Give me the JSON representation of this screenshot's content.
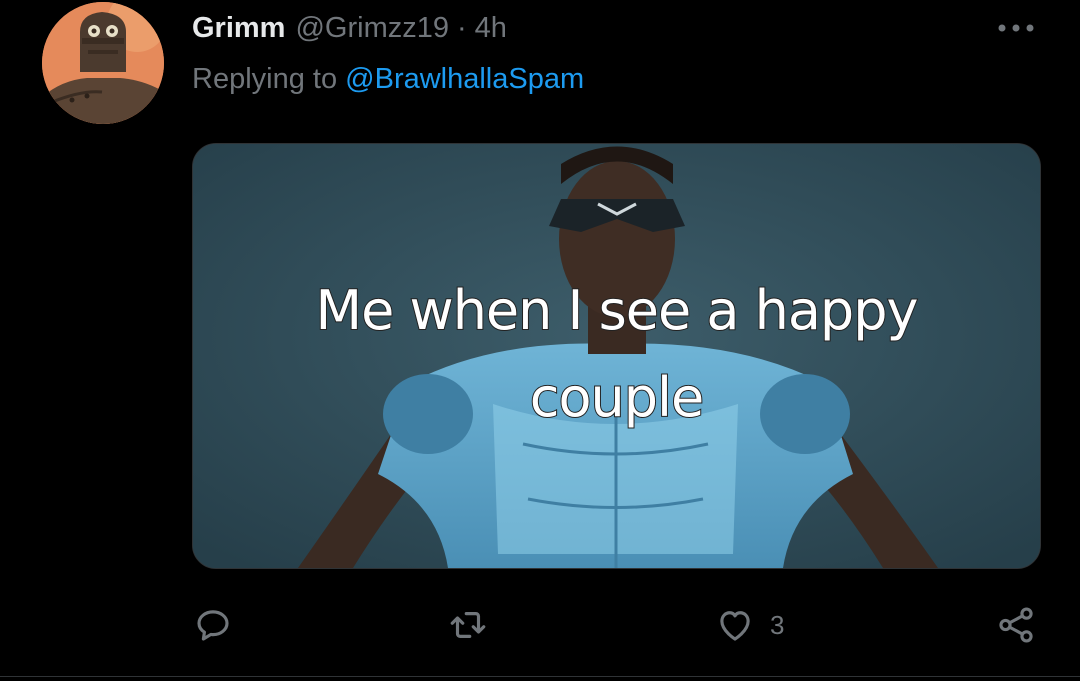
{
  "tweet": {
    "author_name": "Grimm",
    "author_handle": "@Grimzz19",
    "separator": "·",
    "time": "4h",
    "replying_prefix": "Replying to ",
    "replying_to": "@BrawlhallaSpam",
    "media_caption_line1": "Me when I see a happy",
    "media_caption_line2": "couple"
  },
  "actions": {
    "reply": {
      "icon": "reply-icon",
      "count": ""
    },
    "retweet": {
      "icon": "retweet-icon",
      "count": ""
    },
    "like": {
      "icon": "heart-icon",
      "count": "3"
    },
    "share": {
      "icon": "share-icon",
      "count": ""
    }
  },
  "colors": {
    "background": "#000000",
    "text_primary": "#e7e9ea",
    "text_secondary": "#71767b",
    "link": "#1d9bf0"
  }
}
